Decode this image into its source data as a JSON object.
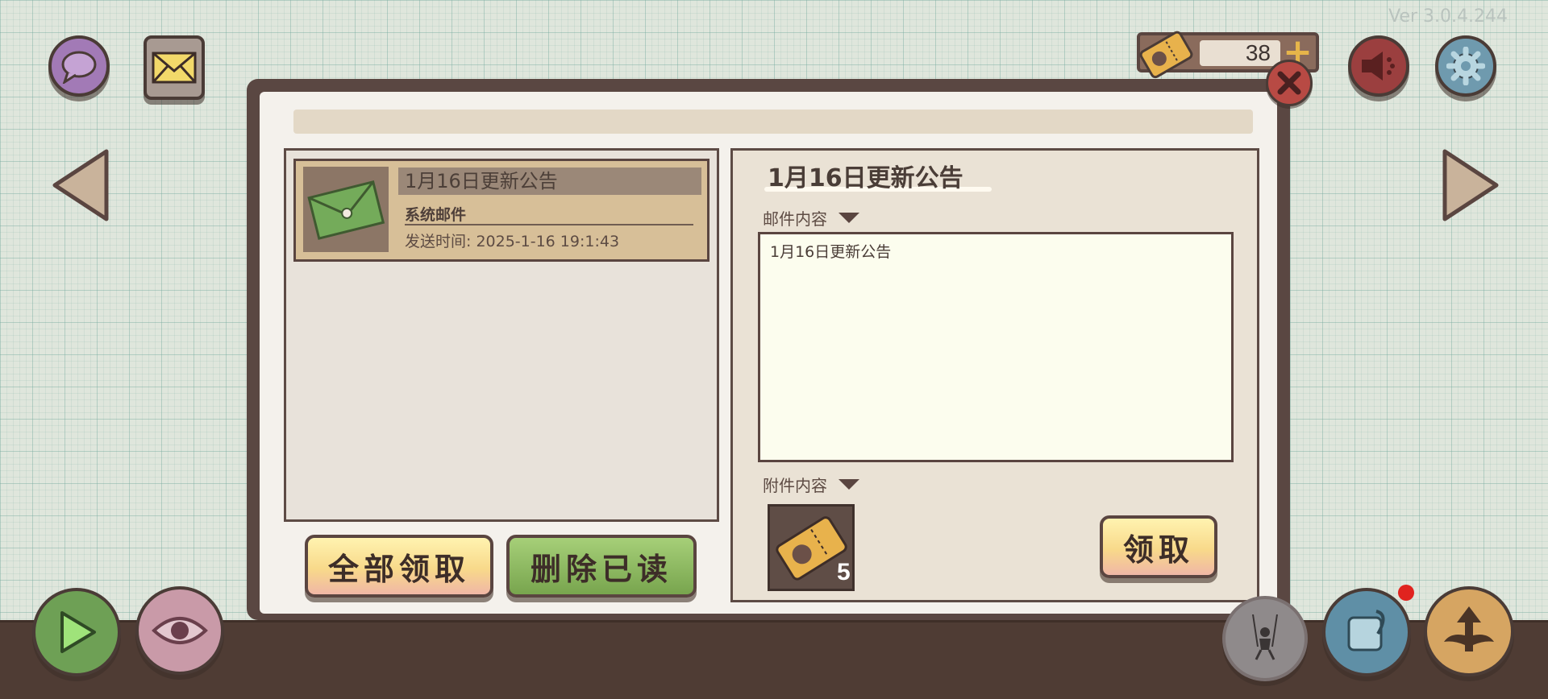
{
  "version": "Ver 3.0.4.244",
  "currency": {
    "icon": "ticket-icon",
    "amount": "38",
    "add_icon": "plus-icon"
  },
  "top_left": {
    "chat_icon": "chat-bubble-icon",
    "mail_icon": "envelope-icon"
  },
  "top_right": {
    "sound_icon": "speaker-icon",
    "settings_icon": "gear-icon"
  },
  "mail_panel": {
    "close_icon": "close-icon",
    "list": [
      {
        "title": "1月16日更新公告",
        "sender": "系统邮件",
        "send_time": "发送时间: 2025-1-16 19:1:43",
        "icon": "envelope-icon"
      }
    ],
    "claim_all_label": "全部领取",
    "delete_read_label": "删除已读",
    "detail": {
      "title": "1月16日更新公告",
      "content_label": "邮件内容",
      "content_text": "1月16日更新公告",
      "attachment_label": "附件内容",
      "attachments": [
        {
          "icon": "ticket-icon",
          "count": "5"
        }
      ],
      "claim_label": "领取"
    }
  },
  "bottom_bar": {
    "play_icon": "play-icon",
    "eye_icon": "eye-icon",
    "character_icon": "swing-figure-icon",
    "scroll_icon": "scroll-quill-icon",
    "upgrade_icon": "winged-arrow-icon"
  },
  "colors": {
    "panel_frame": "#5a4742",
    "button_yellow": "#f8d98a",
    "button_green": "#78a54e",
    "notification": "#e0231f"
  }
}
